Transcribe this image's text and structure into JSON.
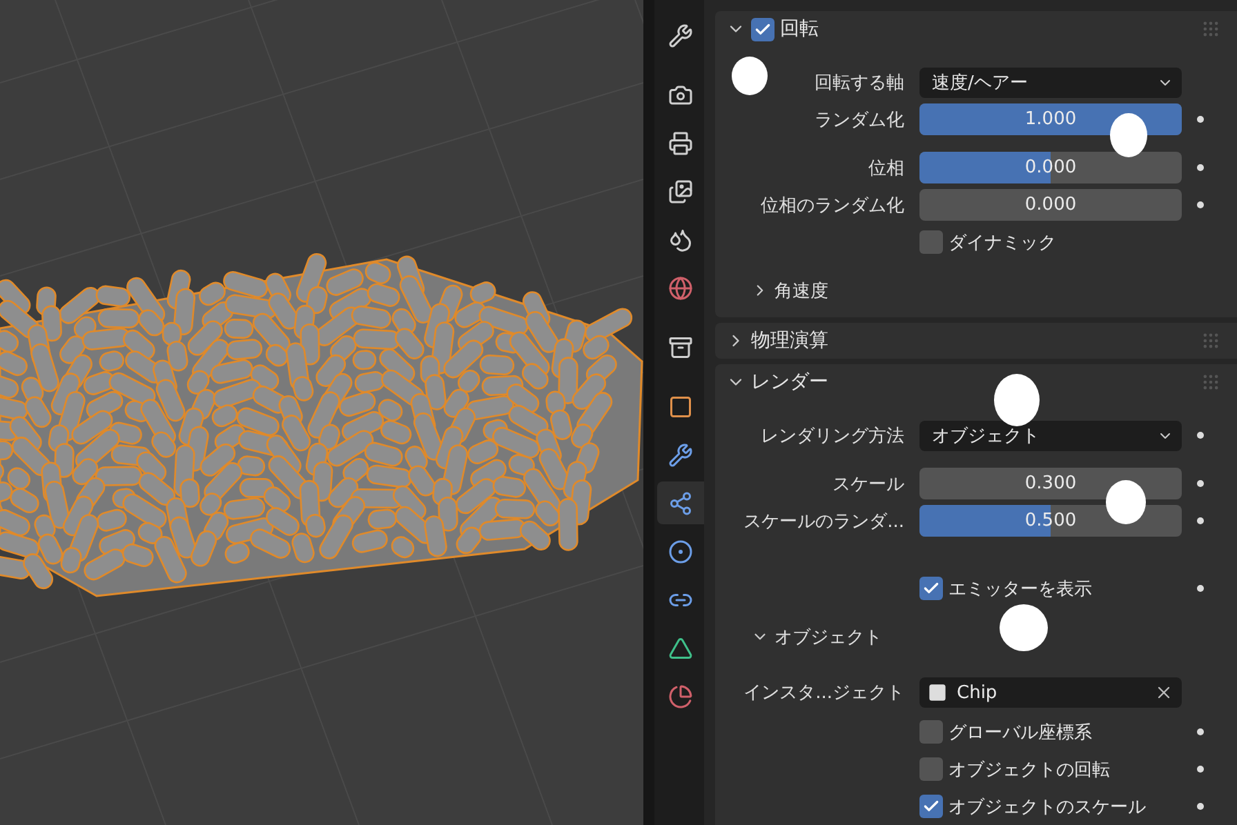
{
  "tabs": [
    {
      "kind": "tool",
      "selected": false
    },
    {
      "kind": "render",
      "selected": false
    },
    {
      "kind": "output",
      "selected": false
    },
    {
      "kind": "view-layer",
      "selected": false
    },
    {
      "kind": "scene",
      "selected": false
    },
    {
      "kind": "world",
      "selected": false
    },
    {
      "kind": "collection",
      "selected": false
    },
    {
      "kind": "object",
      "selected": false
    },
    {
      "kind": "modifier",
      "selected": false
    },
    {
      "kind": "particles",
      "selected": true
    },
    {
      "kind": "physics",
      "selected": false
    },
    {
      "kind": "constraints",
      "selected": false
    },
    {
      "kind": "data",
      "selected": false
    },
    {
      "kind": "material",
      "selected": false
    }
  ],
  "panels": [
    {
      "title": "回転",
      "expanded": true,
      "enabled": true,
      "groups": [
        [
          {
            "kind": "dropdown",
            "label": "回転する軸",
            "value": "速度/ヘアー",
            "animatable": false
          },
          {
            "kind": "slider",
            "label": "ランダム化",
            "value": "1.000",
            "level": 1,
            "animatable": true
          }
        ],
        [
          {
            "kind": "slider",
            "label": "位相",
            "value": "0.000",
            "level": 0.5,
            "animatable": true
          },
          {
            "kind": "slider",
            "label": "位相のランダム化",
            "value": "0.000",
            "level": 0,
            "animatable": true
          },
          {
            "kind": "checkbox",
            "label": "ダイナミック",
            "checked": false,
            "animatable": false
          }
        ],
        [
          {
            "kind": "subpanel",
            "label": "角速度",
            "expanded": false
          }
        ]
      ]
    },
    {
      "title": "物理演算",
      "expanded": false
    },
    {
      "title": "レンダー",
      "expanded": true,
      "groups": [
        [
          {
            "kind": "dropdown",
            "label": "レンダリング方法",
            "value": "オブジェクト",
            "animatable": true
          }
        ],
        [
          {
            "kind": "slider",
            "label": "スケール",
            "value": "0.300",
            "level": 0,
            "animatable": true
          },
          {
            "kind": "slider",
            "label": "スケールのランダ...",
            "value": "0.500",
            "level": 0.5,
            "animatable": true
          }
        ],
        [
          {
            "kind": "checkbox",
            "label": "エミッターを表示",
            "checked": true,
            "animatable": true
          }
        ],
        [
          {
            "kind": "subpanel",
            "label": "オブジェクト",
            "expanded": true,
            "children": [
              {
                "kind": "object",
                "label": "インスタ...ジェクト",
                "value": "Chip",
                "animatable": false
              },
              {
                "kind": "checkbox",
                "label": "グローバル座標系",
                "checked": false,
                "animatable": true
              },
              {
                "kind": "checkbox",
                "label": "オブジェクトの回転",
                "checked": false,
                "animatable": true
              },
              {
                "kind": "checkbox",
                "label": "オブジェクトのスケール",
                "checked": true,
                "animatable": true
              }
            ]
          }
        ]
      ]
    }
  ]
}
